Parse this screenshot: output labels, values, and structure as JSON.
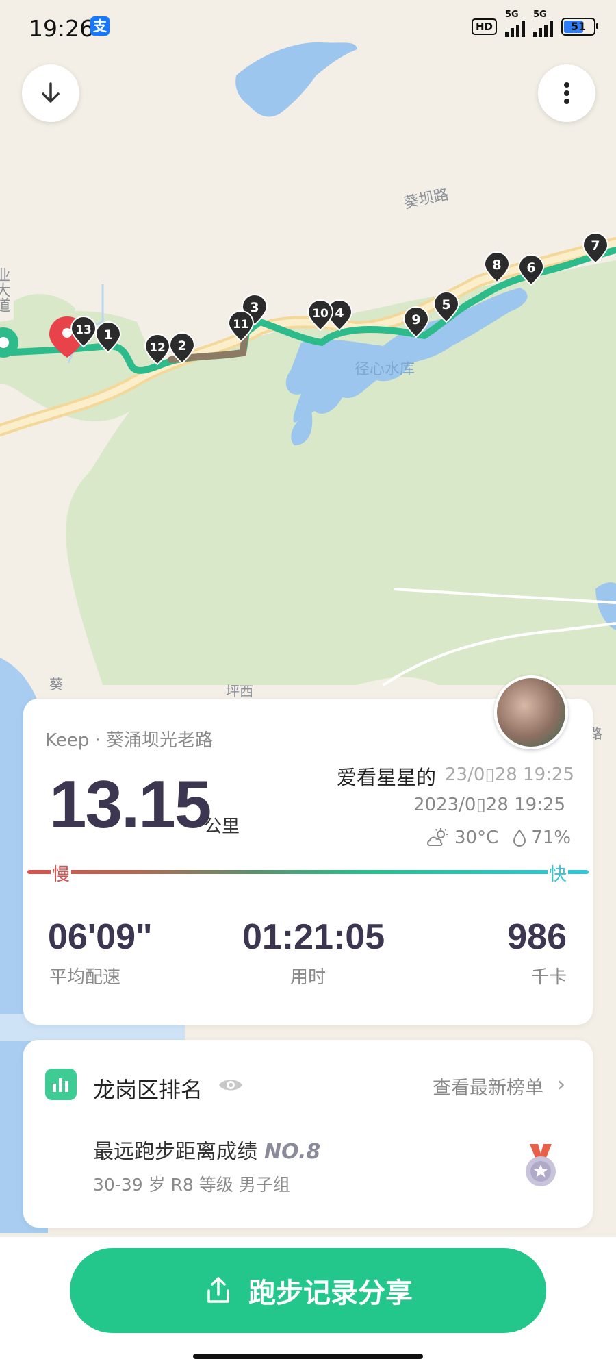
{
  "status_bar": {
    "time": "19:26",
    "alipay_glyph": "支",
    "hd_label": "HD",
    "net1": "5G",
    "net2": "5G",
    "battery": "51"
  },
  "map": {
    "road_label_1": "葵坝路",
    "reservoir_label": "径心水库",
    "road_label_2": "坪西",
    "road_label_3": "葵",
    "side_label": "业大道",
    "side_label_2": "路",
    "markers": [
      "1",
      "2",
      "3",
      "4",
      "5",
      "6",
      "7",
      "8",
      "9",
      "10",
      "11",
      "12",
      "13"
    ]
  },
  "summary": {
    "source": "Keep · 葵涌坝光老路",
    "distance": "13.15",
    "unit": "公里",
    "username": "爱看星星的",
    "date_overlap": "23/0▯28 19:25",
    "date": "2023/0▯28 19:25",
    "temperature": "30°C",
    "humidity": "71%",
    "slow_label": "慢",
    "fast_label": "快",
    "pace_value": "06'09\"",
    "pace_label": "平均配速",
    "time_value": "01:21:05",
    "time_label": "用时",
    "cal_value": "986",
    "cal_label": "千卡"
  },
  "ranking": {
    "title": "龙岗区排名",
    "view_link": "查看最新榜单",
    "chevron": "›",
    "record_title": "最远跑步距离成绩",
    "record_no": "NO.8",
    "record_sub": "30-39 岁 R8 等级 男子组"
  },
  "share_button": {
    "label": "跑步记录分享"
  },
  "colors": {
    "accent": "#24c78b",
    "route": "#2dbb8b",
    "water": "#9cc6ee",
    "park": "#d8e8c8"
  }
}
